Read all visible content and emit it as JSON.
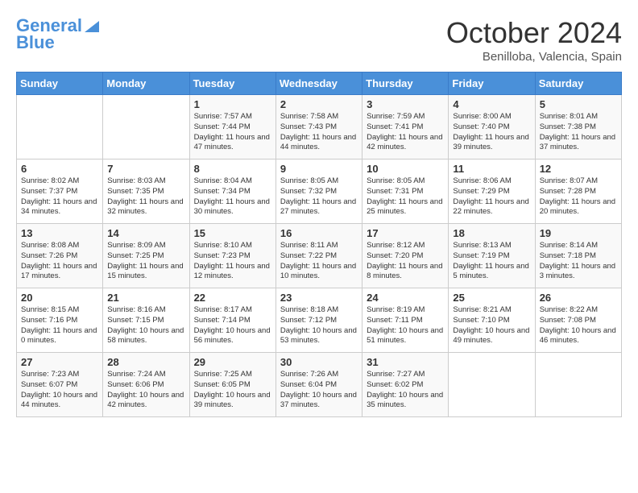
{
  "header": {
    "logo_line1": "General",
    "logo_line2": "Blue",
    "month": "October 2024",
    "location": "Benilloba, Valencia, Spain"
  },
  "days_of_week": [
    "Sunday",
    "Monday",
    "Tuesday",
    "Wednesday",
    "Thursday",
    "Friday",
    "Saturday"
  ],
  "weeks": [
    [
      {
        "day": "",
        "info": ""
      },
      {
        "day": "",
        "info": ""
      },
      {
        "day": "1",
        "info": "Sunrise: 7:57 AM\nSunset: 7:44 PM\nDaylight: 11 hours and 47 minutes."
      },
      {
        "day": "2",
        "info": "Sunrise: 7:58 AM\nSunset: 7:43 PM\nDaylight: 11 hours and 44 minutes."
      },
      {
        "day": "3",
        "info": "Sunrise: 7:59 AM\nSunset: 7:41 PM\nDaylight: 11 hours and 42 minutes."
      },
      {
        "day": "4",
        "info": "Sunrise: 8:00 AM\nSunset: 7:40 PM\nDaylight: 11 hours and 39 minutes."
      },
      {
        "day": "5",
        "info": "Sunrise: 8:01 AM\nSunset: 7:38 PM\nDaylight: 11 hours and 37 minutes."
      }
    ],
    [
      {
        "day": "6",
        "info": "Sunrise: 8:02 AM\nSunset: 7:37 PM\nDaylight: 11 hours and 34 minutes."
      },
      {
        "day": "7",
        "info": "Sunrise: 8:03 AM\nSunset: 7:35 PM\nDaylight: 11 hours and 32 minutes."
      },
      {
        "day": "8",
        "info": "Sunrise: 8:04 AM\nSunset: 7:34 PM\nDaylight: 11 hours and 30 minutes."
      },
      {
        "day": "9",
        "info": "Sunrise: 8:05 AM\nSunset: 7:32 PM\nDaylight: 11 hours and 27 minutes."
      },
      {
        "day": "10",
        "info": "Sunrise: 8:05 AM\nSunset: 7:31 PM\nDaylight: 11 hours and 25 minutes."
      },
      {
        "day": "11",
        "info": "Sunrise: 8:06 AM\nSunset: 7:29 PM\nDaylight: 11 hours and 22 minutes."
      },
      {
        "day": "12",
        "info": "Sunrise: 8:07 AM\nSunset: 7:28 PM\nDaylight: 11 hours and 20 minutes."
      }
    ],
    [
      {
        "day": "13",
        "info": "Sunrise: 8:08 AM\nSunset: 7:26 PM\nDaylight: 11 hours and 17 minutes."
      },
      {
        "day": "14",
        "info": "Sunrise: 8:09 AM\nSunset: 7:25 PM\nDaylight: 11 hours and 15 minutes."
      },
      {
        "day": "15",
        "info": "Sunrise: 8:10 AM\nSunset: 7:23 PM\nDaylight: 11 hours and 12 minutes."
      },
      {
        "day": "16",
        "info": "Sunrise: 8:11 AM\nSunset: 7:22 PM\nDaylight: 11 hours and 10 minutes."
      },
      {
        "day": "17",
        "info": "Sunrise: 8:12 AM\nSunset: 7:20 PM\nDaylight: 11 hours and 8 minutes."
      },
      {
        "day": "18",
        "info": "Sunrise: 8:13 AM\nSunset: 7:19 PM\nDaylight: 11 hours and 5 minutes."
      },
      {
        "day": "19",
        "info": "Sunrise: 8:14 AM\nSunset: 7:18 PM\nDaylight: 11 hours and 3 minutes."
      }
    ],
    [
      {
        "day": "20",
        "info": "Sunrise: 8:15 AM\nSunset: 7:16 PM\nDaylight: 11 hours and 0 minutes."
      },
      {
        "day": "21",
        "info": "Sunrise: 8:16 AM\nSunset: 7:15 PM\nDaylight: 10 hours and 58 minutes."
      },
      {
        "day": "22",
        "info": "Sunrise: 8:17 AM\nSunset: 7:14 PM\nDaylight: 10 hours and 56 minutes."
      },
      {
        "day": "23",
        "info": "Sunrise: 8:18 AM\nSunset: 7:12 PM\nDaylight: 10 hours and 53 minutes."
      },
      {
        "day": "24",
        "info": "Sunrise: 8:19 AM\nSunset: 7:11 PM\nDaylight: 10 hours and 51 minutes."
      },
      {
        "day": "25",
        "info": "Sunrise: 8:21 AM\nSunset: 7:10 PM\nDaylight: 10 hours and 49 minutes."
      },
      {
        "day": "26",
        "info": "Sunrise: 8:22 AM\nSunset: 7:08 PM\nDaylight: 10 hours and 46 minutes."
      }
    ],
    [
      {
        "day": "27",
        "info": "Sunrise: 7:23 AM\nSunset: 6:07 PM\nDaylight: 10 hours and 44 minutes."
      },
      {
        "day": "28",
        "info": "Sunrise: 7:24 AM\nSunset: 6:06 PM\nDaylight: 10 hours and 42 minutes."
      },
      {
        "day": "29",
        "info": "Sunrise: 7:25 AM\nSunset: 6:05 PM\nDaylight: 10 hours and 39 minutes."
      },
      {
        "day": "30",
        "info": "Sunrise: 7:26 AM\nSunset: 6:04 PM\nDaylight: 10 hours and 37 minutes."
      },
      {
        "day": "31",
        "info": "Sunrise: 7:27 AM\nSunset: 6:02 PM\nDaylight: 10 hours and 35 minutes."
      },
      {
        "day": "",
        "info": ""
      },
      {
        "day": "",
        "info": ""
      }
    ]
  ]
}
